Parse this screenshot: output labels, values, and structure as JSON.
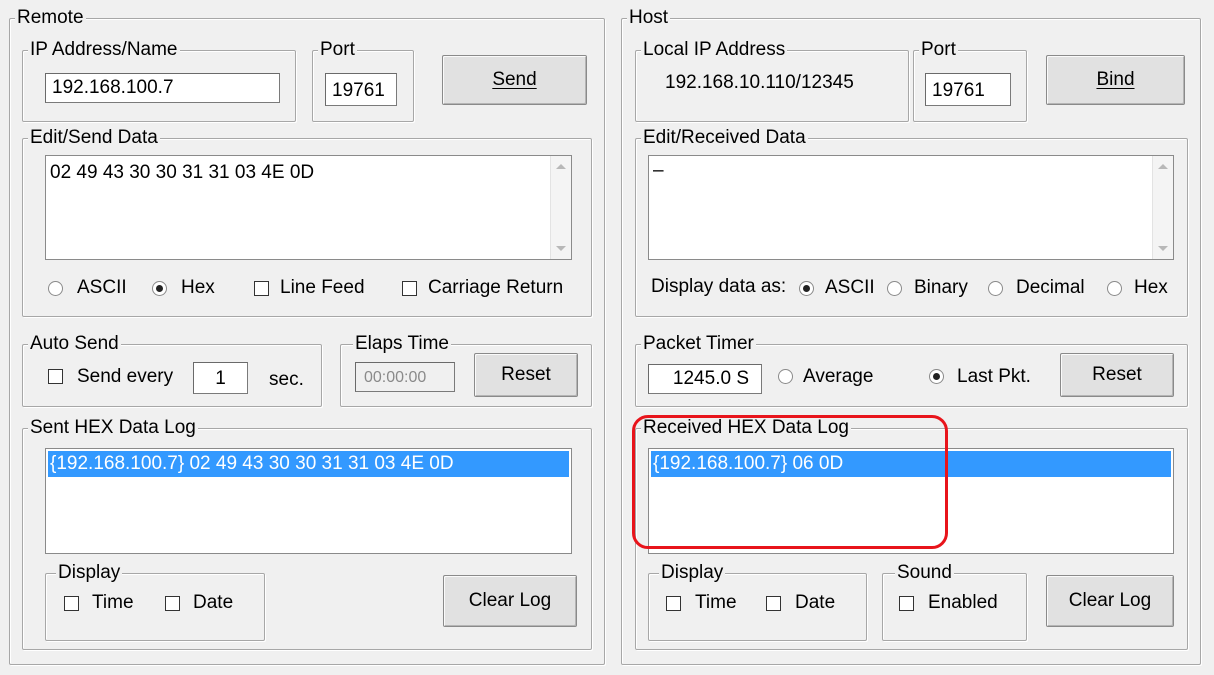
{
  "remote": {
    "title": "Remote",
    "ip_group": "IP Address/Name",
    "ip_value": "192.168.100.7",
    "port_group": "Port",
    "port_value": "19761",
    "send_label": "Send",
    "edit_group": "Edit/Send Data",
    "edit_text": "02 49 43 30 30 31 31 03 4E 0D",
    "format": {
      "ascii": "ASCII",
      "hex": "Hex",
      "line_feed": "Line Feed",
      "carriage_return": "Carriage Return",
      "selected": "Hex"
    },
    "auto_group": "Auto Send",
    "send_every": "Send every",
    "interval_value": "1",
    "sec": "sec.",
    "elaps_group": "Elaps Time",
    "elaps_value": "00:00:00",
    "reset_label": "Reset",
    "log_group": "Sent HEX Data Log",
    "log_entries": [
      "{192.168.100.7} 02 49 43 30 30 31 31 03 4E 0D"
    ],
    "display_group": "Display",
    "time_label": "Time",
    "date_label": "Date",
    "clear_label": "Clear Log"
  },
  "host": {
    "title": "Host",
    "local_group": "Local IP Address",
    "local_value": "192.168.10.110/12345",
    "port_group": "Port",
    "port_value": "19761",
    "bind_label": "Bind",
    "edit_group": "Edit/Received Data",
    "edit_text": "–",
    "display_as": "Display data as:",
    "format": {
      "ascii": "ASCII",
      "binary": "Binary",
      "decimal": "Decimal",
      "hex": "Hex",
      "selected": "ASCII"
    },
    "packet_group": "Packet Timer",
    "packet_value": "1245.0 S",
    "average_label": "Average",
    "last_label": "Last Pkt.",
    "packet_selected": "Last Pkt.",
    "reset_label": "Reset",
    "log_group": "Received HEX Data Log",
    "log_entries": [
      "{192.168.100.7} 06 0D"
    ],
    "display_group": "Display",
    "time_label": "Time",
    "date_label": "Date",
    "sound_group": "Sound",
    "enabled_label": "Enabled",
    "clear_label": "Clear Log"
  },
  "colors": {
    "selection": "#3399ff",
    "highlight": "#e8141b",
    "background": "#f0f0f0"
  }
}
